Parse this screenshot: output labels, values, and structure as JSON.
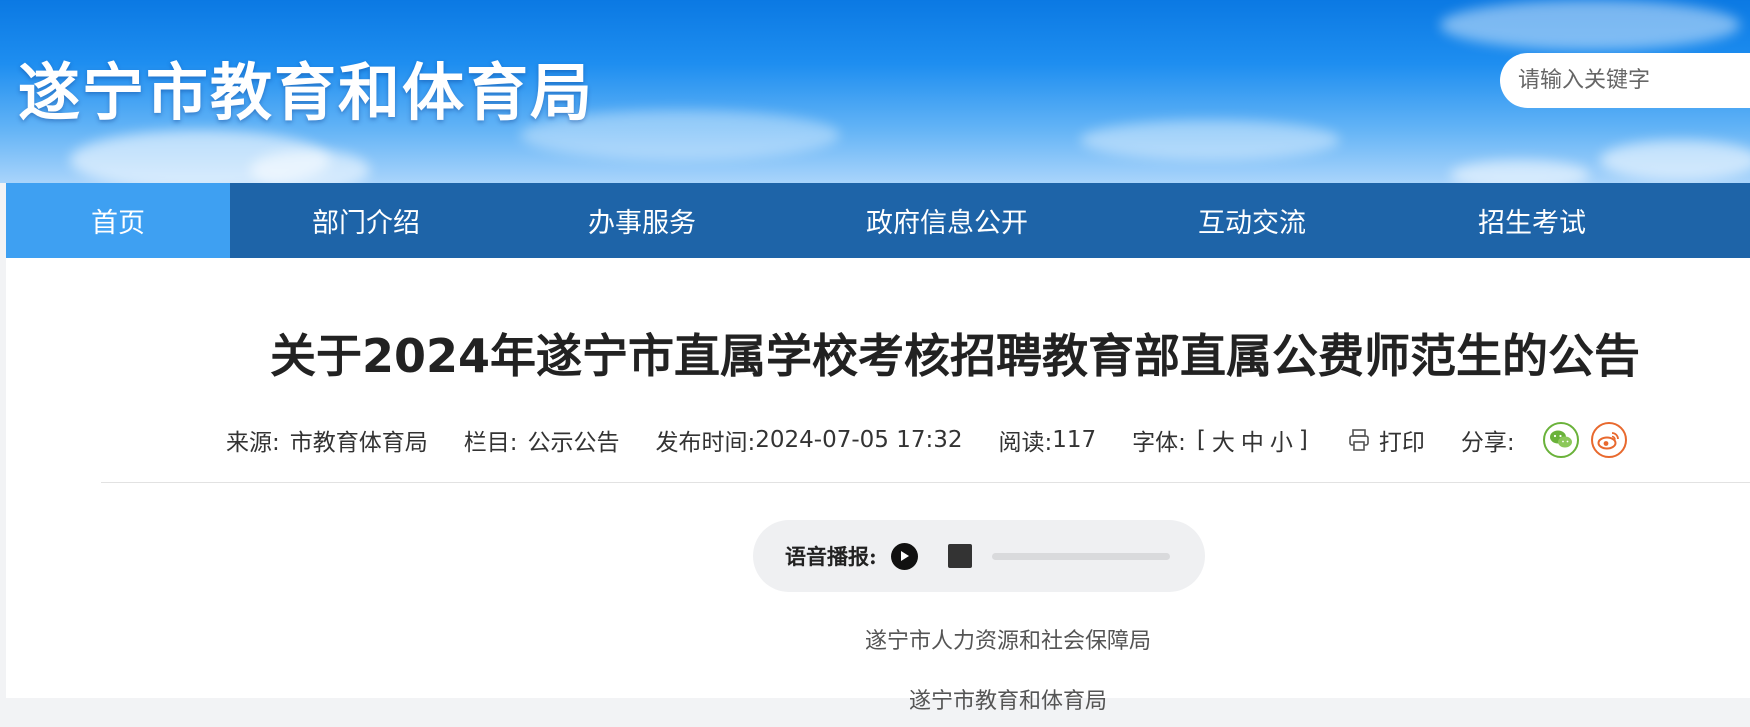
{
  "header": {
    "site_title": "遂宁市教育和体育局",
    "search_placeholder": "请输入关键字"
  },
  "nav": {
    "items": [
      {
        "label": "首页",
        "active": true
      },
      {
        "label": "部门介绍"
      },
      {
        "label": "办事服务"
      },
      {
        "label": "政府信息公开"
      },
      {
        "label": "互动交流"
      },
      {
        "label": "招生考试"
      }
    ]
  },
  "article": {
    "title": "关于2024年遂宁市直属学校考核招聘教育部直属公费师范生的公告",
    "meta": {
      "source_label": "来源:",
      "source_value": "市教育体育局",
      "column_label": "栏目:",
      "column_value": "公示公告",
      "date_label": "发布时间:",
      "date_value": "2024-07-05 17:32",
      "reads_label": "阅读:",
      "reads_value": "117",
      "font_label": "字体:",
      "font_open": "[",
      "font_large": "大",
      "font_medium": "中",
      "font_small": "小",
      "font_close": "]",
      "print_label": "打印",
      "share_label": "分享:"
    },
    "player": {
      "label": "语音播报:",
      "progress": 0
    },
    "body_lines": [
      "遂宁市人力资源和社会保障局",
      "遂宁市教育和体育局"
    ]
  },
  "colors": {
    "nav_bg": "#1e64a8",
    "nav_active": "#3ea0f2",
    "wechat": "#6ab23a",
    "weibo": "#e8692e"
  },
  "icons": {
    "print": "printer-icon",
    "wechat": "wechat-icon",
    "weibo": "weibo-icon",
    "play": "play-icon",
    "stop": "stop-icon"
  }
}
